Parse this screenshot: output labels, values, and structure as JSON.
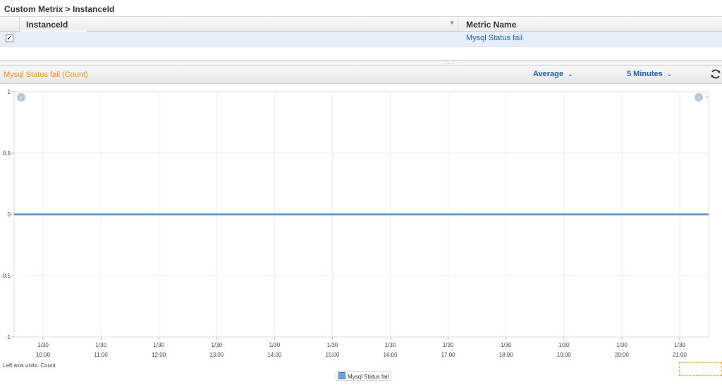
{
  "breadcrumb": "Custom Metrix > InstanceId",
  "grid": {
    "columns": [
      "InstanceId",
      "Metric Name"
    ],
    "rows": [
      {
        "checked": "✓",
        "instance_id": "",
        "metric_name": "Mysql Status fail"
      }
    ]
  },
  "toolbar": {
    "title": "Mysql Status fail (Count)",
    "statistic": "Average",
    "period": "5 Minutes"
  },
  "icons": {
    "sort": "triangle-down-icon",
    "chevron": "chevron-down-icon",
    "refresh": "refresh-icon",
    "nav_left": "arrow-left-circle-icon",
    "nav_right": "arrow-right-circle-icon",
    "nav_end": "double-chevron-right-icon"
  },
  "colors": {
    "accent": "#f08f1e",
    "link": "#1a62b8",
    "series": "#6f9fd8"
  },
  "axis_units": "Left axis units:  Count",
  "chart_data": {
    "type": "line",
    "title": "Mysql Status fail (Count)",
    "ylabel": "",
    "xlabel": "",
    "ylim": [
      -1,
      1
    ],
    "y_ticks": [
      "1",
      "0.5",
      "0",
      "-0.5",
      "-1"
    ],
    "x_ticks": [
      [
        "1/30",
        "10:00"
      ],
      [
        "1/30",
        "11:00"
      ],
      [
        "1/30",
        "12:00"
      ],
      [
        "1/30",
        "13:00"
      ],
      [
        "1/30",
        "14:00"
      ],
      [
        "1/30",
        "15:00"
      ],
      [
        "1/30",
        "16:00"
      ],
      [
        "1/30",
        "17:00"
      ],
      [
        "1/30",
        "18:00"
      ],
      [
        "1/30",
        "19:00"
      ],
      [
        "1/30",
        "20:00"
      ],
      [
        "1/30",
        "21:00"
      ]
    ],
    "x_range": [
      "09:30",
      "21:30"
    ],
    "grid": true,
    "legend": "bottom-center",
    "series": [
      {
        "name": "Mysql Status fail",
        "x": [
          "09:30",
          "21:30"
        ],
        "values": [
          0,
          0
        ]
      }
    ]
  }
}
